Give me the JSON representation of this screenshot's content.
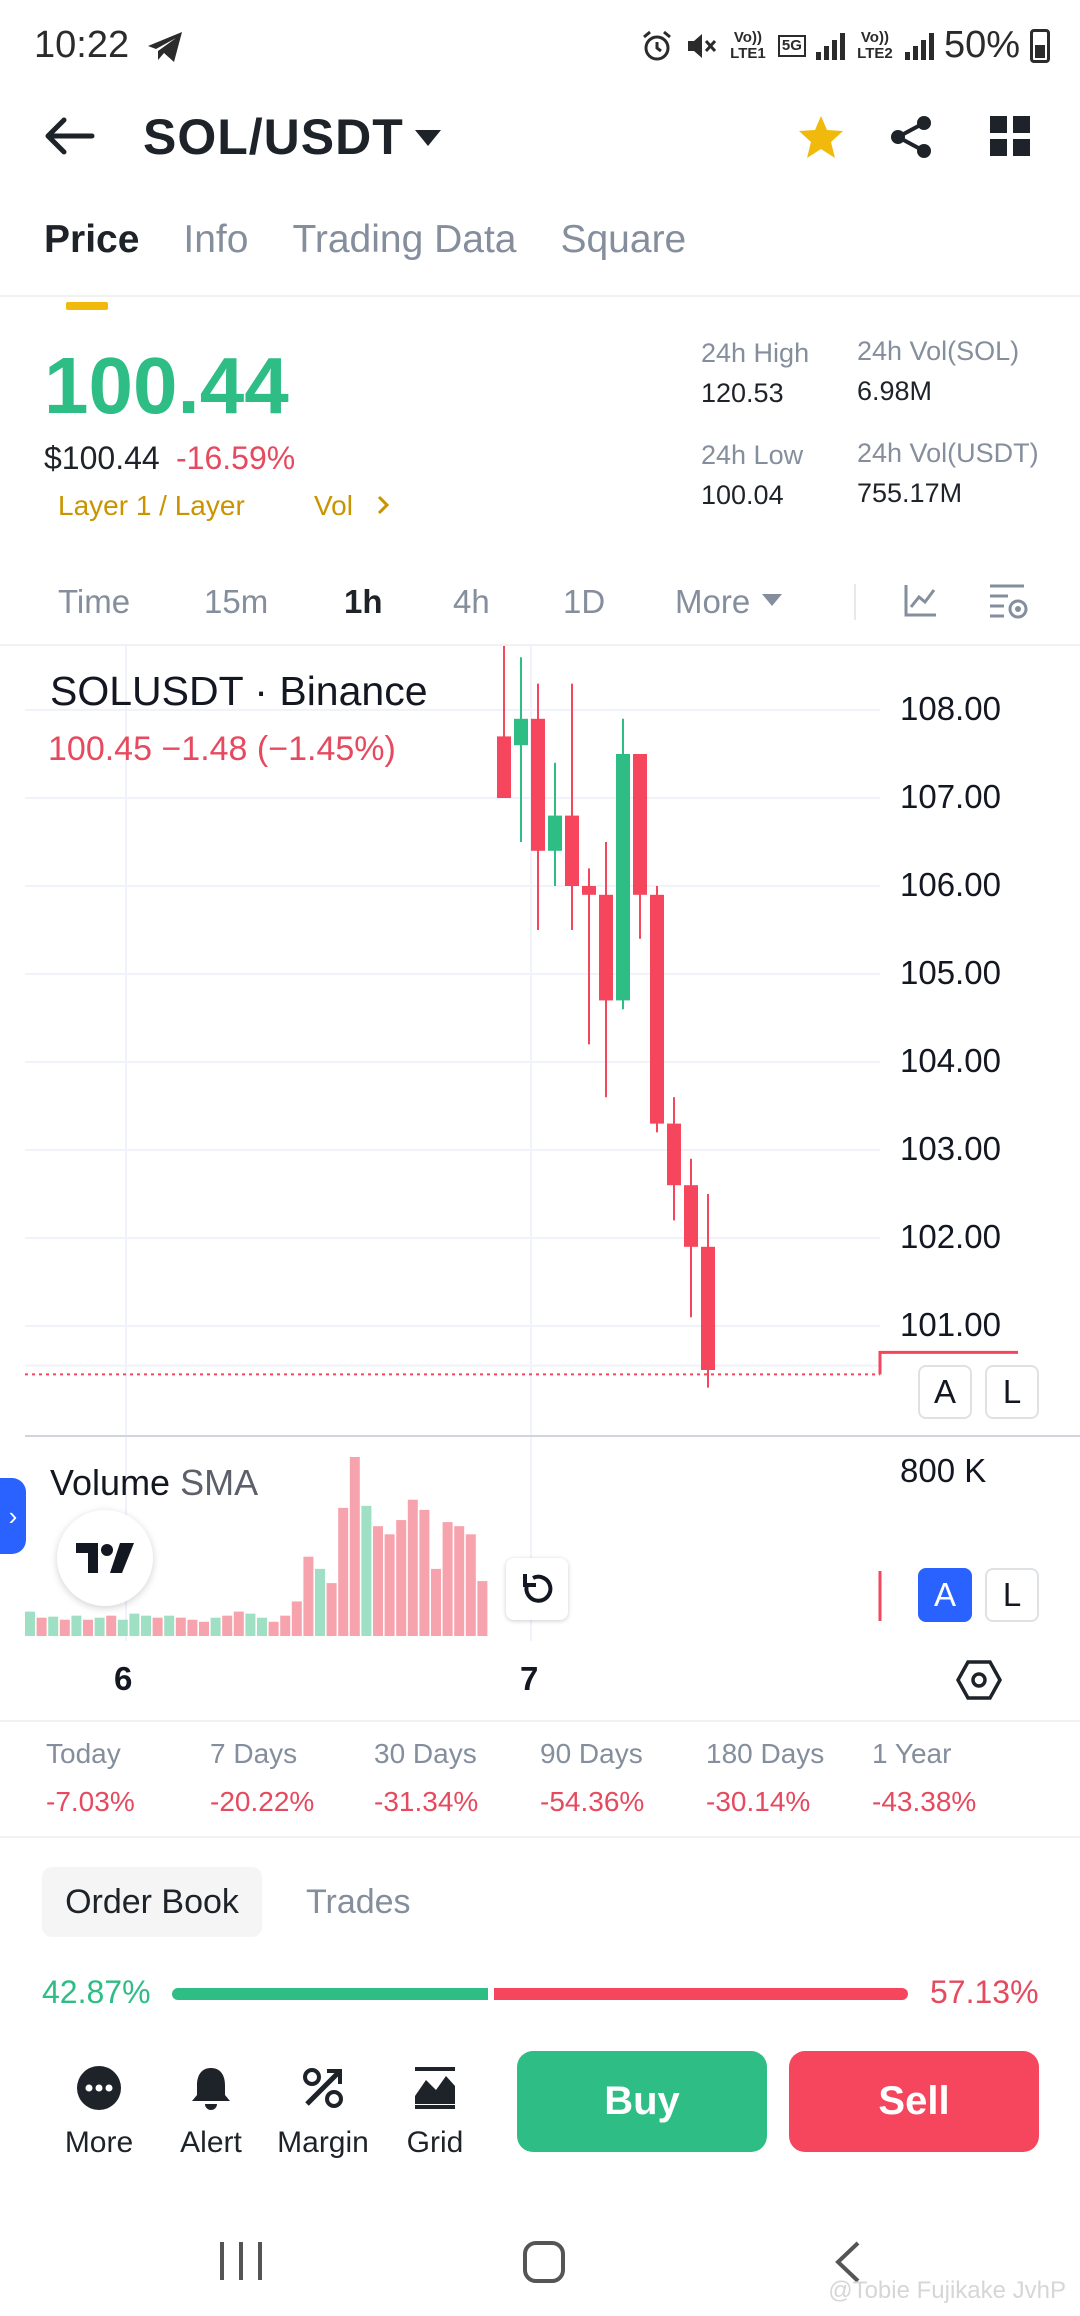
{
  "status_bar": {
    "time": "10:22",
    "net1": "Vo)) LTE1",
    "net_5g": "5G",
    "net2": "Vo)) LTE2",
    "battery": "50%"
  },
  "header": {
    "pair": "SOL/USDT",
    "back_icon": "back-arrow-icon",
    "favorite_icon": "star-icon",
    "share_icon": "share-icon",
    "grid_icon": "grid-icon"
  },
  "tabs": [
    "Price",
    "Info",
    "Trading Data",
    "Square"
  ],
  "ticker": {
    "last_price": "100.44",
    "usd_price": "$100.44",
    "change_pct": "-16.59%",
    "tag_layer": "Layer 1 / Layer",
    "tag_vol": "Vol",
    "high_label": "24h High",
    "high_value": "120.53",
    "low_label": "24h Low",
    "low_value": "100.04",
    "vol_sol_label": "24h Vol(SOL)",
    "vol_sol_value": "6.98M",
    "vol_usdt_label": "24h Vol(USDT)",
    "vol_usdt_value": "755.17M"
  },
  "intervals": {
    "items": [
      "Time",
      "15m",
      "1h",
      "4h",
      "1D",
      "More"
    ],
    "selected": "1h"
  },
  "chart": {
    "symbol_title": "SOLUSDT · Binance",
    "legend_values": "100.45  −1.48 (−1.45%)",
    "volume_title": "Volume",
    "volume_sma": "SMA",
    "volume_axis_label": "800 K",
    "date_labels": [
      "6",
      "7"
    ],
    "btn_a": "A",
    "btn_l": "L",
    "colors": {
      "up": "#2ebd85",
      "down": "#f6465d",
      "vol_up": "#9fe0c4",
      "vol_down": "#f7a3ae"
    }
  },
  "chart_data": {
    "type": "candlestick",
    "title": "SOLUSDT · Binance",
    "y_ticks": [
      "108.00",
      "107.00",
      "106.00",
      "105.00",
      "104.00",
      "103.00",
      "102.00",
      "101.00"
    ],
    "ylim": [
      100.4,
      108.8
    ],
    "last_price": 100.45,
    "candles": [
      {
        "o": 107.7,
        "h": 108.8,
        "l": 107.3,
        "c": 107.0
      },
      {
        "o": 107.6,
        "h": 108.6,
        "l": 106.5,
        "c": 107.9
      },
      {
        "o": 107.9,
        "h": 108.3,
        "l": 105.5,
        "c": 106.4
      },
      {
        "o": 106.4,
        "h": 107.4,
        "l": 106.0,
        "c": 106.8
      },
      {
        "o": 106.8,
        "h": 108.3,
        "l": 105.5,
        "c": 106.0
      },
      {
        "o": 106.0,
        "h": 106.2,
        "l": 104.2,
        "c": 105.9
      },
      {
        "o": 105.9,
        "h": 106.5,
        "l": 103.6,
        "c": 104.7
      },
      {
        "o": 104.7,
        "h": 107.9,
        "l": 104.6,
        "c": 107.5
      },
      {
        "o": 107.5,
        "h": 107.5,
        "l": 105.4,
        "c": 105.9
      },
      {
        "o": 105.9,
        "h": 106.0,
        "l": 103.2,
        "c": 103.3
      },
      {
        "o": 103.3,
        "h": 103.6,
        "l": 102.2,
        "c": 102.6
      },
      {
        "o": 102.6,
        "h": 102.9,
        "l": 101.1,
        "c": 101.9
      },
      {
        "o": 101.9,
        "h": 102.5,
        "l": 100.3,
        "c": 100.5
      }
    ],
    "volume_bars": [
      {
        "v": 120,
        "up": true
      },
      {
        "v": 90,
        "up": false
      },
      {
        "v": 95,
        "up": true
      },
      {
        "v": 80,
        "up": false
      },
      {
        "v": 100,
        "up": true
      },
      {
        "v": 80,
        "up": false
      },
      {
        "v": 90,
        "up": true
      },
      {
        "v": 100,
        "up": false
      },
      {
        "v": 80,
        "up": true
      },
      {
        "v": 110,
        "up": true
      },
      {
        "v": 100,
        "up": true
      },
      {
        "v": 90,
        "up": false
      },
      {
        "v": 100,
        "up": true
      },
      {
        "v": 90,
        "up": false
      },
      {
        "v": 80,
        "up": false
      },
      {
        "v": 70,
        "up": false
      },
      {
        "v": 90,
        "up": true
      },
      {
        "v": 100,
        "up": false
      },
      {
        "v": 120,
        "up": false
      },
      {
        "v": 110,
        "up": true
      },
      {
        "v": 90,
        "up": true
      },
      {
        "v": 70,
        "up": false
      },
      {
        "v": 100,
        "up": false
      },
      {
        "v": 170,
        "up": false
      },
      {
        "v": 390,
        "up": false
      },
      {
        "v": 330,
        "up": true
      },
      {
        "v": 260,
        "up": false
      },
      {
        "v": 630,
        "up": false
      },
      {
        "v": 880,
        "up": false
      },
      {
        "v": 640,
        "up": true
      },
      {
        "v": 540,
        "up": false
      },
      {
        "v": 500,
        "up": false
      },
      {
        "v": 570,
        "up": false
      },
      {
        "v": 670,
        "up": false
      },
      {
        "v": 620,
        "up": false
      },
      {
        "v": 330,
        "up": false
      },
      {
        "v": 560,
        "up": false
      },
      {
        "v": 540,
        "up": false
      },
      {
        "v": 500,
        "up": false
      },
      {
        "v": 270,
        "up": false
      }
    ]
  },
  "performance": [
    {
      "label": "Today",
      "value": "-7.03%"
    },
    {
      "label": "7 Days",
      "value": "-20.22%"
    },
    {
      "label": "30 Days",
      "value": "-31.34%"
    },
    {
      "label": "90 Days",
      "value": "-54.36%"
    },
    {
      "label": "180 Days",
      "value": "-30.14%"
    },
    {
      "label": "1 Year",
      "value": "-43.38%"
    }
  ],
  "order_book": {
    "tab_active": "Order Book",
    "tab_other": "Trades",
    "buy_ratio": "42.87%",
    "sell_ratio": "57.13%",
    "buy_fraction": 0.4287
  },
  "bottom_bar": {
    "actions": [
      "More",
      "Alert",
      "Margin",
      "Grid"
    ],
    "buy_label": "Buy",
    "sell_label": "Sell"
  },
  "watermark": "@Tobie Fujikake JvhP"
}
